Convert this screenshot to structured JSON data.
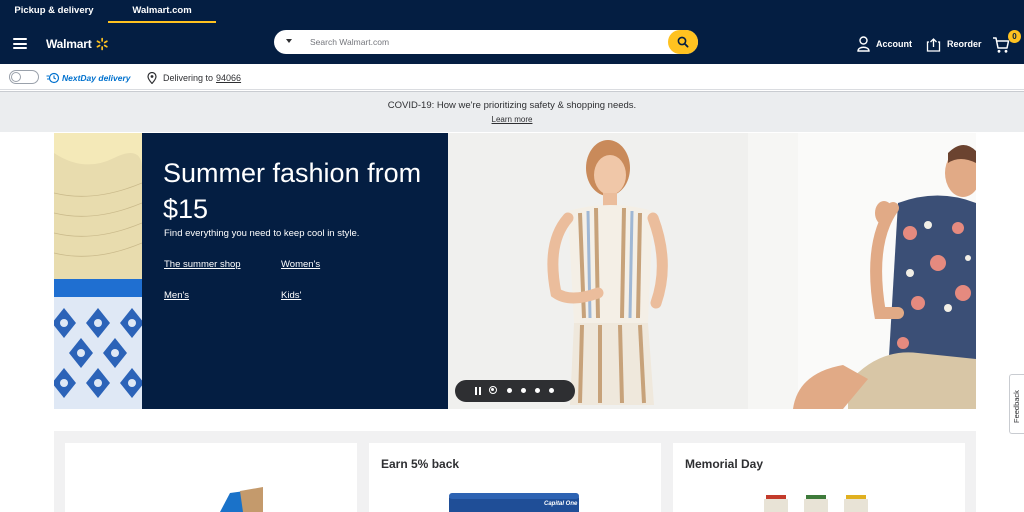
{
  "top_tabs": [
    {
      "label": "Pickup & delivery"
    },
    {
      "label": "Walmart.com"
    }
  ],
  "header": {
    "logo_text": "Walmart",
    "search_placeholder": "Search Walmart.com",
    "account_label": "Account",
    "reorder_label": "Reorder",
    "cart_count": "0"
  },
  "delivery": {
    "nextday_label": "NextDay delivery",
    "delivering_label": "Delivering to",
    "zip": "94066"
  },
  "banner": {
    "message": "COVID-19: How we're prioritizing safety & shopping needs.",
    "link": "Learn more"
  },
  "hero": {
    "title": "Summer fashion from $15",
    "subtitle": "Find everything you need to keep cool in style.",
    "links": [
      "The summer shop",
      "Women's",
      "Men's",
      "Kids'"
    ],
    "slide_count": 5,
    "active_slide": 1
  },
  "feedback_label": "Feedback",
  "cards": [
    {
      "title": ""
    },
    {
      "title": "Earn 5% back"
    },
    {
      "title": "Memorial Day"
    }
  ],
  "colors": {
    "navy": "#041e42",
    "yellow": "#ffc220",
    "blue": "#0071ce"
  }
}
